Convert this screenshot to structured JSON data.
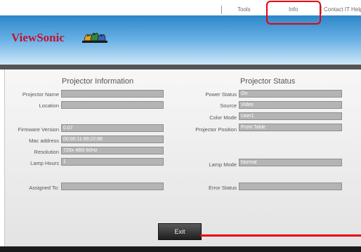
{
  "nav": {
    "items": [
      "Tools",
      "Info",
      "Contact IT Help"
    ]
  },
  "brand": {
    "logo_text": "ViewSonic"
  },
  "projector_info": {
    "title": "Projector Information",
    "fields": [
      {
        "label": "Projector Name",
        "value": ""
      },
      {
        "label": "Location",
        "value": ""
      },
      {
        "label": "Firmware Version",
        "value": "0.07"
      },
      {
        "label": "Mac address",
        "value": "00:00:11:99:22:88"
      },
      {
        "label": "Resolution",
        "value": "720x 480i 60Hz"
      },
      {
        "label": "Lamp Hours",
        "value": "1"
      },
      {
        "label": "Assigned To:",
        "value": ""
      }
    ]
  },
  "projector_status": {
    "title": "Projector Status",
    "fields": [
      {
        "label": "Power Status",
        "value": "On"
      },
      {
        "label": "Source",
        "value": "Video"
      },
      {
        "label": "Color Mode",
        "value": "User1"
      },
      {
        "label": "Projector Position",
        "value": "Front Table"
      },
      {
        "label": "Lamp Mode",
        "value": "Normal"
      },
      {
        "label": "Error Status",
        "value": ""
      }
    ]
  },
  "actions": {
    "exit_label": "Exit"
  },
  "colors": {
    "highlight": "#e8000f",
    "logo_red": "#c41230",
    "banner_blue": "#2d86c8"
  }
}
